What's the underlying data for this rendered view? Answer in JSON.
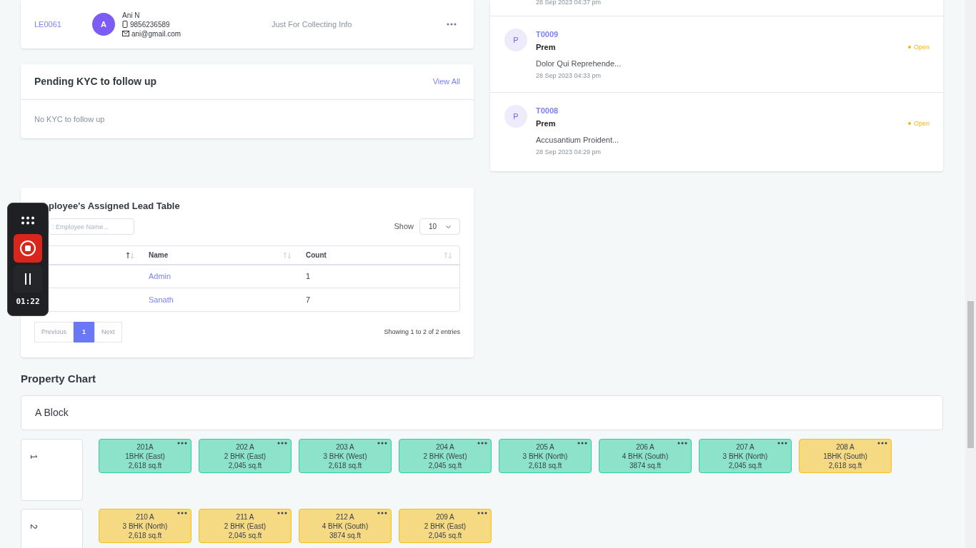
{
  "leads": [
    {
      "id": "LE0061",
      "avatar": "A",
      "name": "Ani N",
      "phone": "9856236589",
      "email": "ani@gmail.com",
      "source": "Just For Collecting Info"
    }
  ],
  "kyc": {
    "title": "Pending KYC to follow up",
    "link": "View All",
    "empty": "No KYC to follow up"
  },
  "tickets": {
    "cut_time": "28 Sep 2023 04:37 pm",
    "items": [
      {
        "avatar": "P",
        "id": "T0009",
        "name": "Prem",
        "status": "Open",
        "subject": "Dolor Qui Reprehende...",
        "time": "28 Sep 2023 04:33 pm"
      },
      {
        "avatar": "P",
        "id": "T0008",
        "name": "Prem",
        "status": "Open",
        "subject": "Accusantium Proident...",
        "time": "28 Sep 2023 04:29 pm"
      }
    ]
  },
  "employee_table": {
    "title": "ployee's Assigned Lead Table",
    "search_placeholder": ": Employee Name...",
    "show_label": "Show",
    "page_size": "10",
    "columns": [
      {
        "sorted": true
      },
      {
        "label": "Name",
        "sorted": false
      },
      {
        "label": "Count",
        "sorted": false
      }
    ],
    "rows": [
      {
        "name": "Admin",
        "count": "1"
      },
      {
        "name": "Sanath",
        "count": "7"
      }
    ],
    "pagination": {
      "previous": "Previous",
      "pages": [
        {
          "label": "1",
          "selected": true
        }
      ],
      "next": "Next"
    },
    "info": "Showing 1 to 2 of 2 entries"
  },
  "recorder": {
    "time": "01:22"
  },
  "property_chart": {
    "title": "Property Chart",
    "block": "A Block",
    "floors": [
      {
        "label": "1",
        "units": [
          {
            "name": "201A",
            "type": "1BHK (East)",
            "area": "2,618 sq.ft",
            "color": "#8de3c9"
          },
          {
            "name": "202 A",
            "type": "2 BHK (East)",
            "area": "2,045 sq.ft",
            "color": "#8de3c9"
          },
          {
            "name": "203 A",
            "type": "3 BHK (West)",
            "area": "2,618 sq.ft",
            "color": "#8de3c9"
          },
          {
            "name": "204 A",
            "type": "2 BHK (West)",
            "area": "2,045 sq.ft",
            "color": "#8de3c9"
          },
          {
            "name": "205 A",
            "type": "3 BHK (North)",
            "area": "2,618 sq.ft",
            "color": "#8de3c9"
          },
          {
            "name": "206 A",
            "type": "4 BHK (South)",
            "area": "3874 sq.ft",
            "color": "#8de3c9"
          },
          {
            "name": "207 A",
            "type": "3 BHK (North)",
            "area": "2,045 sq.ft",
            "color": "#8de3c9"
          },
          {
            "name": "208 A",
            "type": "1BHK (South)",
            "area": "2,618 sq.ft",
            "color": "#f5da83"
          }
        ]
      },
      {
        "label": "2",
        "units": [
          {
            "name": "210 A",
            "type": "3 BHK (North)",
            "area": "2,618 sq.ft",
            "color": "#f5da83"
          },
          {
            "name": "211 A",
            "type": "2 BHK (East)",
            "area": "2,045 sq.ft",
            "color": "#f5da83"
          },
          {
            "name": "212 A",
            "type": "4 BHK (South)",
            "area": "3874 sq.ft",
            "color": "#f5da83"
          },
          {
            "name": "209 A",
            "type": "2 BHK (East)",
            "area": "2,045 sq.ft",
            "color": "#f5da83"
          }
        ]
      }
    ]
  }
}
